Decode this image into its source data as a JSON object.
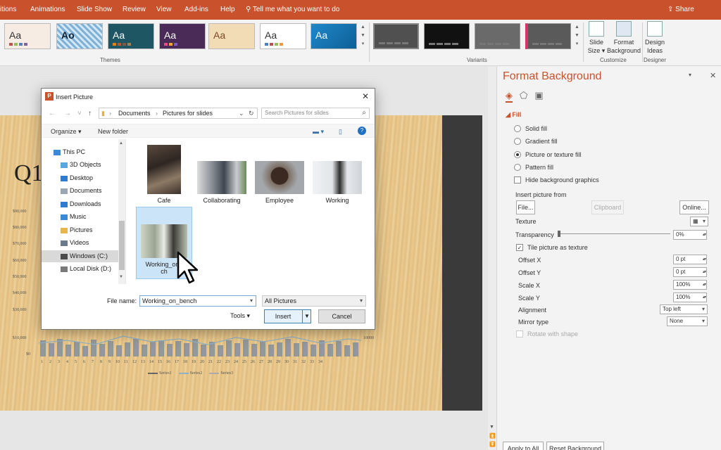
{
  "ribbon": {
    "tabs": [
      "itions",
      "Animations",
      "Slide Show",
      "Review",
      "View",
      "Add-ins",
      "Help"
    ],
    "tell_me": "Tell me what you want to do",
    "share": "Share",
    "theme_thumb_text": "Aa",
    "theme_thumb_text_alt": "Ao",
    "themes_label": "Themes",
    "variants_label": "Variants",
    "customize_label": "Customize",
    "designer_label": "Designer",
    "slide_size_line1": "Slide",
    "slide_size_line2": "Size ▾",
    "format_bg_line1": "Format",
    "format_bg_line2": "Background",
    "design_ideas_line1": "Design",
    "design_ideas_line2": "Ideas"
  },
  "slide": {
    "title": "Q1",
    "y_ticks": [
      "$90,000",
      "$80,000",
      "$70,000",
      "$60,000",
      "$50,000",
      "$40,000",
      "$30,000",
      "$20,000",
      "$10,000",
      "$0"
    ],
    "y2_tick": "10000",
    "x_ticks": [
      "1",
      "2",
      "3",
      "4",
      "5",
      "6",
      "7",
      "8",
      "9",
      "10",
      "11",
      "12",
      "13",
      "14",
      "15",
      "16",
      "17",
      "18",
      "19",
      "20",
      "21",
      "22",
      "23",
      "24",
      "25",
      "26",
      "27",
      "28",
      "29",
      "30",
      "31",
      "32",
      "33",
      "34"
    ],
    "legend": [
      "Series1",
      "Series2",
      "Series3"
    ]
  },
  "pane": {
    "title": "Format Background",
    "fill_heading": "Fill",
    "options": [
      "Solid fill",
      "Gradient fill",
      "Picture or texture fill",
      "Pattern fill"
    ],
    "selected_option": "Picture or texture fill",
    "hide_bg": "Hide background graphics",
    "insert_from": "Insert picture from",
    "file_btn": "File...",
    "clipboard_btn": "Clipboard",
    "online_btn": "Online...",
    "texture": "Texture",
    "transparency": "Transparency",
    "transparency_value": "0%",
    "tile": "Tile picture as texture",
    "offset_x": "Offset X",
    "offset_x_value": "0 pt",
    "offset_y": "Offset Y",
    "offset_y_value": "0 pt",
    "scale_x": "Scale X",
    "scale_x_value": "100%",
    "scale_y": "Scale Y",
    "scale_y_value": "100%",
    "alignment": "Alignment",
    "alignment_value": "Top left",
    "mirror": "Mirror type",
    "mirror_value": "None",
    "rotate": "Rotate with shape",
    "apply_all": "Apply to All",
    "reset": "Reset Background"
  },
  "dialog": {
    "title": "Insert Picture",
    "breadcrumb": [
      "Documents",
      "Pictures for slides"
    ],
    "search_placeholder": "Search Pictures for slides",
    "organize": "Organize ▾",
    "new_folder": "New folder",
    "tree": [
      "This PC",
      "3D Objects",
      "Desktop",
      "Documents",
      "Downloads",
      "Music",
      "Pictures",
      "Videos",
      "Windows (C:)",
      "Local Disk (D:)"
    ],
    "selected_tree": "Windows (C:)",
    "files": [
      "Cafe",
      "Collaborating",
      "Employee",
      "Working",
      "Working_on_bench"
    ],
    "selected_file_caption_line1": "Working_on_",
    "selected_file_caption_line2": "ch",
    "file_name_label": "File name:",
    "file_name_value": "Working_on_bench",
    "file_type": "All Pictures",
    "tools": "Tools ▾",
    "insert": "Insert",
    "cancel": "Cancel"
  },
  "colors": {
    "accent": "#c9522d",
    "selection": "#cce4f7"
  }
}
